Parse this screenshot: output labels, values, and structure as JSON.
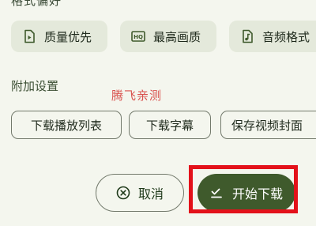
{
  "header": {
    "section_title_cut": "格式偏好"
  },
  "format_options": [
    {
      "label": "质量优先",
      "icon": "video-file-icon"
    },
    {
      "label": "最高画质",
      "icon": "hq-icon"
    },
    {
      "label": "音频格式",
      "icon": "music-note-icon"
    }
  ],
  "additional_settings": {
    "label": "附加设置",
    "options": [
      {
        "label": "下载播放列表"
      },
      {
        "label": "下载字幕"
      },
      {
        "label": "保存视频封面"
      }
    ]
  },
  "watermark": "腾飞亲测",
  "actions": {
    "cancel_label": "取消",
    "start_label": "开始下载"
  },
  "colors": {
    "background": "#f4f6ee",
    "chip_fill": "#e4e9db",
    "primary": "#3f5a2c",
    "highlight": "#e3111a",
    "watermark": "#d9534f"
  }
}
